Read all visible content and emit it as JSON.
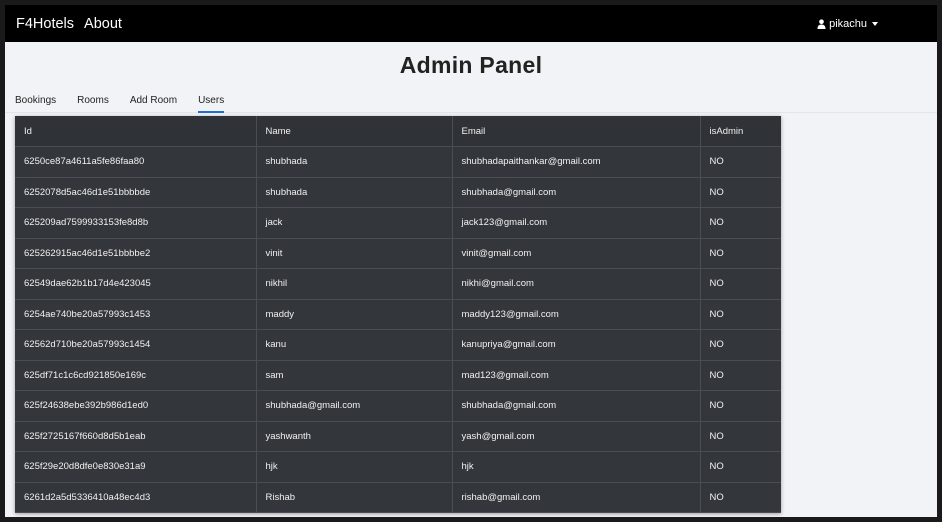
{
  "navbar": {
    "brand": "F4Hotels",
    "about": "About",
    "user": "pikachu"
  },
  "page": {
    "title": "Admin Panel"
  },
  "tabs": [
    {
      "label": "Bookings",
      "active": false
    },
    {
      "label": "Rooms",
      "active": false
    },
    {
      "label": "Add Room",
      "active": false
    },
    {
      "label": "Users",
      "active": true
    }
  ],
  "table": {
    "headers": [
      "Id",
      "Name",
      "Email",
      "isAdmin"
    ],
    "rows": [
      [
        "6250ce87a4611a5fe86faa80",
        "shubhada",
        "shubhadapaithankar@gmail.com",
        "NO"
      ],
      [
        "6252078d5ac46d1e51bbbbde",
        "shubhada",
        "shubhada@gmail.com",
        "NO"
      ],
      [
        "625209ad7599933153fe8d8b",
        "jack",
        "jack123@gmail.com",
        "NO"
      ],
      [
        "625262915ac46d1e51bbbbe2",
        "vinit",
        "vinit@gmail.com",
        "NO"
      ],
      [
        "62549dae62b1b17d4e423045",
        "nikhil",
        "nikhi@gmail.com",
        "NO"
      ],
      [
        "6254ae740be20a57993c1453",
        "maddy",
        "maddy123@gmail.com",
        "NO"
      ],
      [
        "62562d710be20a57993c1454",
        "kanu",
        "kanupriya@gmail.com",
        "NO"
      ],
      [
        "625df71c1c6cd921850e169c",
        "sam",
        "mad123@gmail.com",
        "NO"
      ],
      [
        "625f24638ebe392b986d1ed0",
        "shubhada@gmail.com",
        "shubhada@gmail.com",
        "NO"
      ],
      [
        "625f2725167f660d8d5b1eab",
        "yashwanth",
        "yash@gmail.com",
        "NO"
      ],
      [
        "625f29e20d8dfe0e830e31a9",
        "hjk",
        "hjk",
        "NO"
      ],
      [
        "6261d2a5d5336410a48ec4d3",
        "Rishab",
        "rishab@gmail.com",
        "NO"
      ]
    ]
  }
}
